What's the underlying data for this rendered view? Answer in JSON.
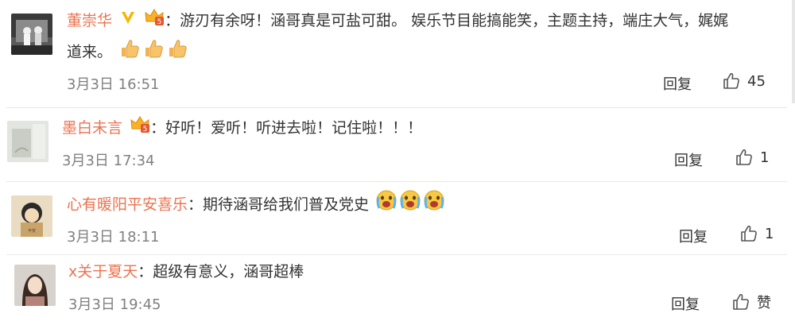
{
  "comments": [
    {
      "user": "董崇华",
      "sep": "：",
      "text_line1": "游刃有余呀！涵哥真是可盐可甜。 娱乐节目能搞能笑，主题主持，端庄大气，娓娓",
      "text_line2": "道来。",
      "time": "3月3日 16:51",
      "reply": "回复",
      "likes": "45",
      "badges": [
        "vip-v-icon",
        "gold-crown-icon"
      ],
      "emojis": [
        "thumbs-up-emoji",
        "thumbs-up-emoji",
        "thumbs-up-emoji"
      ]
    },
    {
      "user": "墨白未言",
      "sep": "：",
      "text": "好听！爱听！听进去啦！记住啦！！！",
      "time": "3月3日 17:34",
      "reply": "回复",
      "likes": "1",
      "badges": [
        "gold-crown-icon"
      ]
    },
    {
      "user": "心有暖阳平安喜乐",
      "sep": "：",
      "text": "期待涵哥给我们普及党史",
      "time": "3月3日 18:11",
      "reply": "回复",
      "likes": "1",
      "emojis": [
        "crying-face-emoji",
        "crying-face-emoji",
        "crying-face-emoji"
      ]
    },
    {
      "user": "x关于夏天",
      "sep": "：",
      "text": "超级有意义，涵哥超棒",
      "time": "3月3日 19:45",
      "reply": "回复",
      "likes": "赞"
    }
  ],
  "colors": {
    "username": "#eb7350",
    "time": "#808080",
    "text": "#333333",
    "divider": "#e8e8e8"
  }
}
